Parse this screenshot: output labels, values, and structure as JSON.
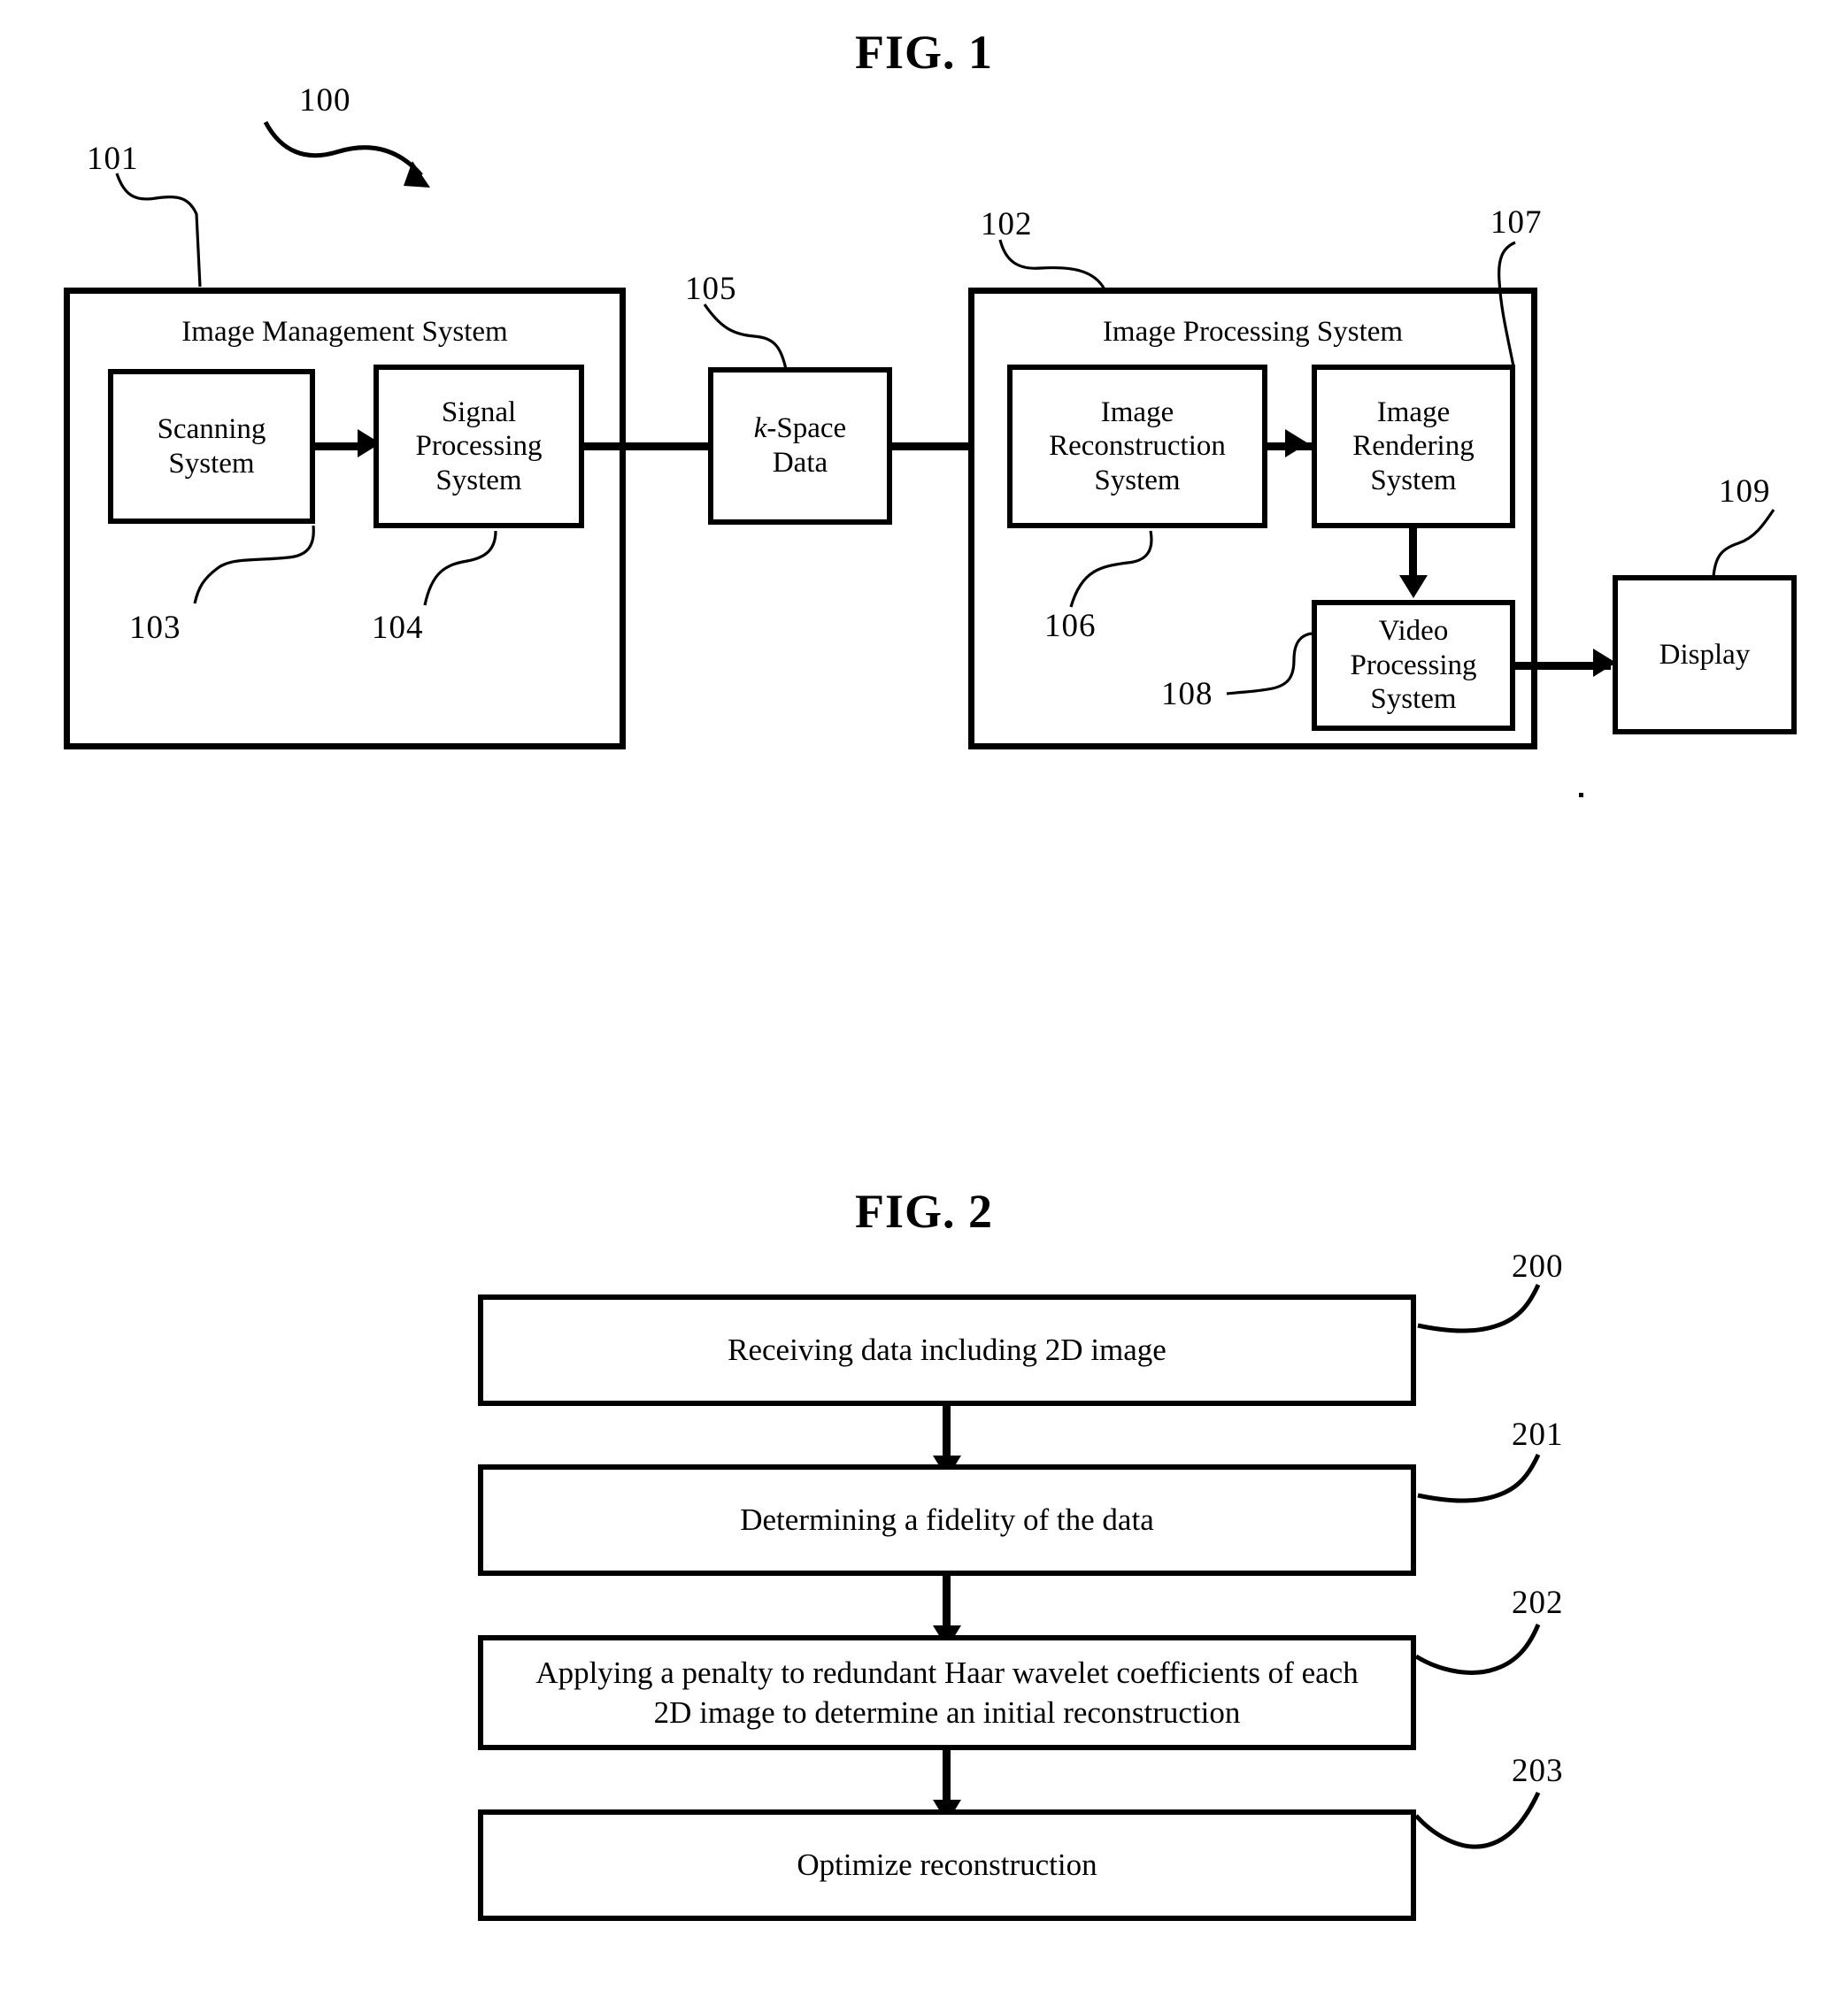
{
  "figures": [
    {
      "title": "FIG. 1",
      "reference_numbers": [
        "100",
        "101",
        "102",
        "103",
        "104",
        "105",
        "106",
        "107",
        "108",
        "109"
      ],
      "containers": [
        {
          "ref": "101",
          "label": "Image Management System"
        },
        {
          "ref": "102",
          "label": "Image Processing System"
        }
      ],
      "blocks": [
        {
          "ref": "103",
          "label": "Scanning System",
          "lines": [
            "Scanning",
            "System"
          ]
        },
        {
          "ref": "104",
          "label": "Signal Processing System",
          "lines": [
            "Signal",
            "Processing",
            "System"
          ]
        },
        {
          "ref": "105",
          "label": "k-Space Data",
          "lines": [
            "k-Space",
            "Data"
          ]
        },
        {
          "ref": "106",
          "label": "Image Reconstruction System",
          "lines": [
            "Image",
            "Reconstruction",
            "System"
          ]
        },
        {
          "ref": "107",
          "label": "Image Rendering System",
          "lines": [
            "Image",
            "Rendering",
            "System"
          ]
        },
        {
          "ref": "108",
          "label": "Video Processing System",
          "lines": [
            "Video",
            "Processing",
            "System"
          ]
        },
        {
          "ref": "109",
          "label": "Display",
          "lines": [
            "Display"
          ]
        }
      ]
    },
    {
      "title": "FIG. 2",
      "reference_numbers": [
        "200",
        "201",
        "202",
        "203"
      ],
      "steps": [
        {
          "ref": "200",
          "text": "Receiving data including 2D image",
          "lines": [
            "Receiving data including 2D image"
          ]
        },
        {
          "ref": "201",
          "text": "Determining a fidelity of the data",
          "lines": [
            "Determining a fidelity of the data"
          ]
        },
        {
          "ref": "202",
          "text": "Applying a penalty to redundant Haar wavelet coefficients of each 2D image to determine an initial reconstruction",
          "lines": [
            "Applying a penalty to redundant Haar wavelet coefficients of each",
            "2D image to determine an initial reconstruction"
          ]
        },
        {
          "ref": "203",
          "text": "Optimize reconstruction",
          "lines": [
            "Optimize reconstruction"
          ]
        }
      ]
    }
  ],
  "fig1": {
    "title": "FIG. 1",
    "system_ref": "100",
    "mgmt": {
      "ref": "101",
      "label": "Image Management System",
      "scanning": {
        "ref": "103",
        "l1": "Scanning",
        "l2": "System"
      },
      "signal": {
        "ref": "104",
        "l1": "Signal",
        "l2": "Processing",
        "l3": "System"
      }
    },
    "kspace": {
      "ref": "105",
      "k": "k",
      "l1": "-Space",
      "l2": "Data"
    },
    "proc": {
      "ref": "102",
      "label": "Image Processing System",
      "recon": {
        "ref": "106",
        "l1": "Image",
        "l2": "Reconstruction",
        "l3": "System"
      },
      "render": {
        "ref": "107",
        "l1": "Image",
        "l2": "Rendering",
        "l3": "System"
      },
      "video": {
        "ref": "108",
        "l1": "Video",
        "l2": "Processing",
        "l3": "System"
      }
    },
    "display": {
      "ref": "109",
      "label": "Display"
    }
  },
  "fig2": {
    "title": "FIG. 2",
    "step1": {
      "ref": "200",
      "text": "Receiving data including 2D image"
    },
    "step2": {
      "ref": "201",
      "text": "Determining a fidelity of the data"
    },
    "step3": {
      "ref": "202",
      "line1": "Applying a penalty to redundant Haar wavelet coefficients of each",
      "line2": "2D image to determine an initial reconstruction"
    },
    "step4": {
      "ref": "203",
      "text": "Optimize reconstruction"
    }
  },
  "colors": {
    "ink": "#000000",
    "paper": "#ffffff"
  }
}
